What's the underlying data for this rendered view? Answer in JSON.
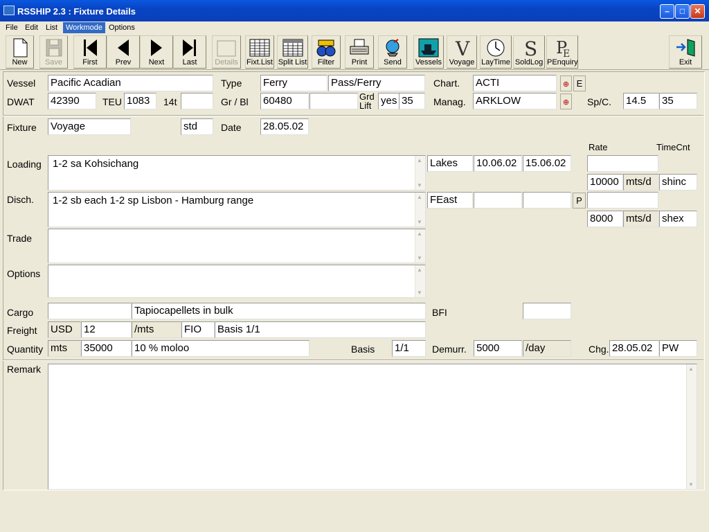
{
  "window": {
    "title": "RSSHIP 2.3 : Fixture Details"
  },
  "menu": [
    "File",
    "Edit",
    "List",
    "Workmode",
    "Options"
  ],
  "toolbar": {
    "new": "New",
    "save": "Save",
    "first": "First",
    "prev": "Prev",
    "next": "Next",
    "last": "Last",
    "details": "Details",
    "fixt_list": "Fixt.List",
    "split_list": "Split List",
    "filter": "Filter",
    "print": "Print",
    "send": "Send",
    "vessels": "Vessels",
    "voyage": "Voyage",
    "laytime": "LayTime",
    "soldlog": "SoldLog",
    "penquiry": "PEnquiry",
    "exit": "Exit"
  },
  "labels": {
    "vessel": "Vessel",
    "type": "Type",
    "chart": "Chart.",
    "dwat": "DWAT",
    "teu": "TEU",
    "t14": "14t",
    "gr_bl": "Gr / Bl",
    "grd": "Grd",
    "lift": "Lift",
    "manag": "Manag.",
    "spc": "Sp/C.",
    "fixture": "Fixture",
    "date": "Date",
    "rate": "Rate",
    "timecnt": "TimeCnt",
    "loading": "Loading",
    "disch": "Disch.",
    "trade": "Trade",
    "options": "Options",
    "cargo": "Cargo",
    "bfi": "BFI",
    "freight": "Freight",
    "quantity": "Quantity",
    "basis": "Basis",
    "demurr": "Demurr.",
    "chg": "Chg.",
    "remark": "Remark"
  },
  "values": {
    "vessel": "Pacific Acadian",
    "type1": "Ferry",
    "type2": "Pass/Ferry",
    "chart": "ACTI",
    "dwat": "42390",
    "teu": "1083",
    "t14": "",
    "gr": "60480",
    "bl": "",
    "grd_lift": "yes",
    "grd_val": "35",
    "manag": "ARKLOW",
    "sp": "14.5",
    "sp2": "35",
    "fixture": "Voyage",
    "std": "std",
    "date": "28.05.02",
    "loading": "1-2 sa Kohsichang",
    "load_region": "Lakes",
    "load_from": "10.06.02",
    "load_to": "15.06.02",
    "load_rate_top": "",
    "load_rate": "10000",
    "load_unit": "mts/d",
    "load_terms": "shinc",
    "disch": "1-2 sb each 1-2 sp Lisbon - Hamburg range",
    "disch_region": "FEast",
    "disch_from": "",
    "disch_to": "",
    "disch_rate_top": "",
    "disch_rate": "8000",
    "disch_unit": "mts/d",
    "disch_terms": "shex",
    "trade": "",
    "options": "",
    "cargo_code": "",
    "cargo": "Tapiocapellets in bulk",
    "bfi": "",
    "freight_cur": "USD",
    "freight": "12",
    "freight_unit": "/mts",
    "freight_terms": "FIO",
    "freight_basis": "Basis 1/1",
    "qty_unit": "mts",
    "qty": "35000",
    "qty_tol": "10 % moloo",
    "basis": "1/1",
    "demurr": "5000",
    "demurr_unit": "/day",
    "chg_date": "28.05.02",
    "chg_by": "PW",
    "remark": "",
    "btn_e": "E",
    "btn_p": "P"
  },
  "icons": [
    "zoom-icon",
    "zoom-icon"
  ]
}
